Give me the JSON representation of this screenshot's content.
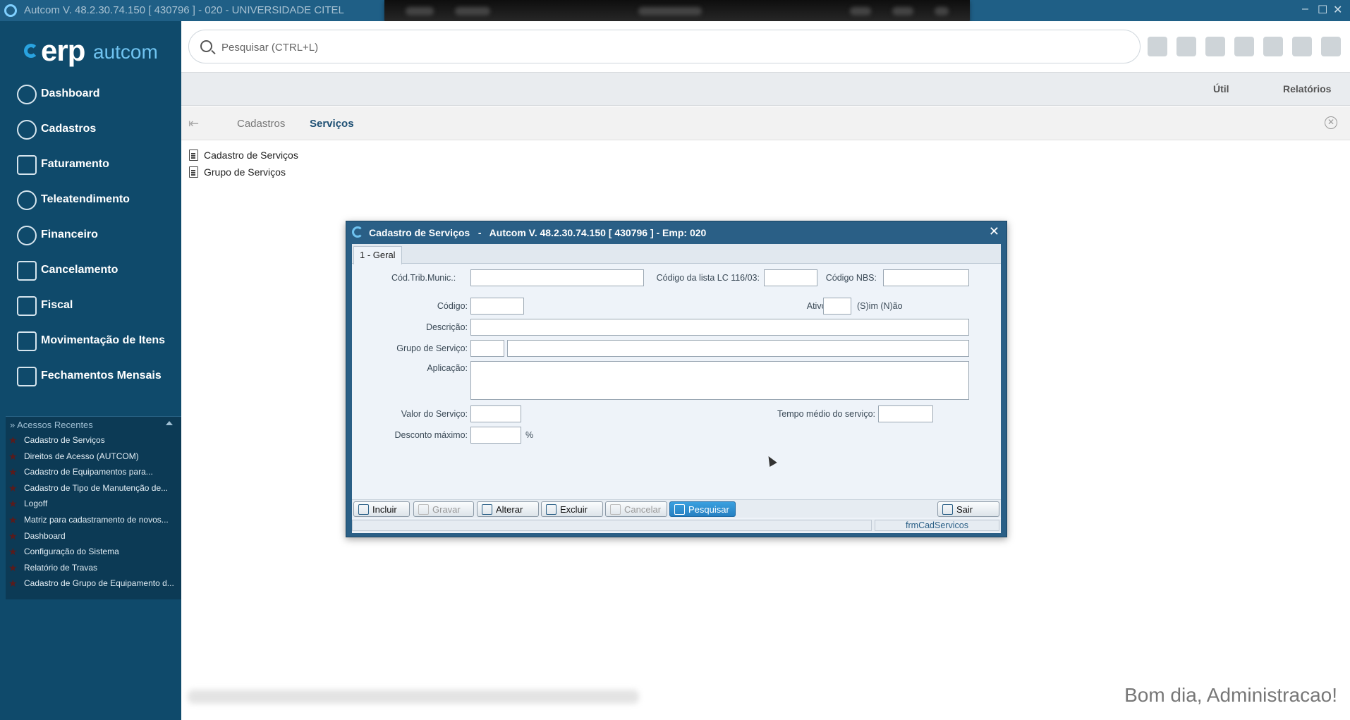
{
  "window": {
    "title": "Autcom V. 48.2.30.74.150 [ 430796 ] - 020 - UNIVERSIDADE CITEL"
  },
  "sidebar": {
    "logo_erp": "erp",
    "logo_autcom": "autcom",
    "items": [
      {
        "label": "Dashboard",
        "icon": "speedometer-icon"
      },
      {
        "label": "Cadastros",
        "icon": "user-add-icon"
      },
      {
        "label": "Faturamento",
        "icon": "tag-icon"
      },
      {
        "label": "Teleatendimento",
        "icon": "headset-icon"
      },
      {
        "label": "Financeiro",
        "icon": "dollar-icon"
      },
      {
        "label": "Cancelamento",
        "icon": "cancel-clipboard-icon"
      },
      {
        "label": "Fiscal",
        "icon": "notebook-icon"
      },
      {
        "label": "Movimentação de Itens",
        "icon": "truck-icon"
      },
      {
        "label": "Fechamentos Mensais",
        "icon": "calendar-check-icon"
      }
    ],
    "recent": {
      "header": "» Acessos Recentes",
      "items": [
        "Cadastro de Serviços",
        "Direitos de Acesso (AUTCOM)",
        "Cadastro de Equipamentos para...",
        "Cadastro de Tipo de Manutenção de...",
        "Logoff",
        "Matriz para cadastramento de novos...",
        "Dashboard",
        "Configuração do Sistema",
        "Relatório de Travas",
        "Cadastro de Grupo de Equipamento d..."
      ]
    }
  },
  "search": {
    "placeholder": "Pesquisar (CTRL+L)"
  },
  "menubar": {
    "util": "Útil",
    "relatorios": "Relatórios"
  },
  "breadcrumb": {
    "back": "⇤",
    "parent": "Cadastros",
    "current": "Serviços"
  },
  "page_links": [
    "Cadastro de Serviços",
    "Grupo de Serviços"
  ],
  "greeting": "Bom dia, Administracao!",
  "dialog": {
    "title": "Cadastro de Serviços   -   Autcom V. 48.2.30.74.150 [ 430796 ] - Emp: 020",
    "close": "✕",
    "tab": "1 - Geral",
    "labels": {
      "cod_trib": "Cód.Trib.Munic.:",
      "cod_lc": "Código da lista LC 116/03:",
      "cod_nbs": "Código NBS:",
      "codigo": "Código:",
      "ativo": "Ativo:",
      "sim_nao": "(S)im (N)ão",
      "descricao": "Descrição:",
      "grupo": "Grupo de Serviço:",
      "aplicacao": "Aplicação:",
      "valor": "Valor do Serviço:",
      "tempo": "Tempo médio do serviço:",
      "desconto": "Desconto máximo:",
      "percent": "%"
    },
    "buttons": {
      "incluir": "Incluir",
      "gravar": "Gravar",
      "alterar": "Alterar",
      "excluir": "Excluir",
      "cancelar": "Cancelar",
      "pesquisar": "Pesquisar",
      "sair": "Sair"
    },
    "status_right": "frmCadServicos"
  }
}
